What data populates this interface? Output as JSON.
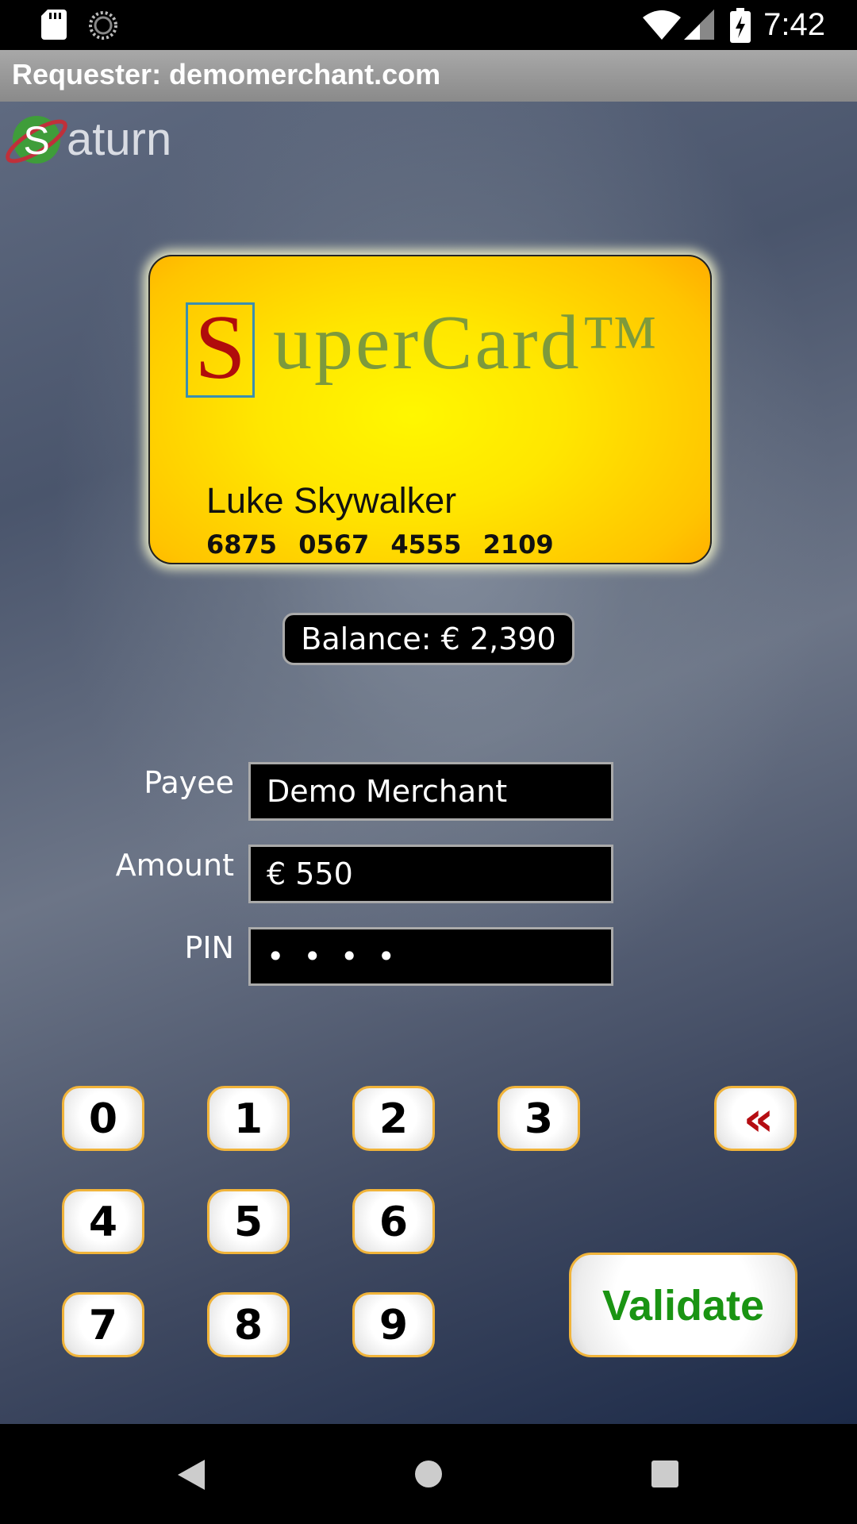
{
  "status_bar": {
    "time": "7:42",
    "icons": [
      "sd-card-icon",
      "sync-icon",
      "wifi-icon",
      "signal-icon",
      "battery-charging-icon"
    ]
  },
  "requester": {
    "text": "Requester: demomerchant.com"
  },
  "app": {
    "logo_letter": "S",
    "logo_text": "aturn"
  },
  "card": {
    "brand_initial": "S",
    "brand_rest": "uperCard™",
    "holder": "Luke Skywalker",
    "number": "6875 0567 4555 2109",
    "colors": {
      "gold": "#ffd200",
      "brand_red": "#b00c0c",
      "brand_green": "#7d9a3c",
      "logo_box": "#3a8fb0"
    }
  },
  "balance": {
    "text": "Balance: € 2,390"
  },
  "form": {
    "payee_label": "Payee",
    "payee_value": "Demo Merchant",
    "amount_label": "Amount",
    "amount_value": "€ 550",
    "pin_label": "PIN",
    "pin_value": "• • • •"
  },
  "keypad": {
    "keys": [
      "0",
      "1",
      "2",
      "3",
      "4",
      "5",
      "6",
      "7",
      "8",
      "9"
    ],
    "backspace": "«",
    "validate": "Validate",
    "colors": {
      "key_border": "#f1b43a",
      "validate_text": "#1a9413",
      "backspace_text": "#b50d12"
    }
  },
  "nav_bar": {
    "icons": [
      "back-icon",
      "home-icon",
      "recents-icon"
    ]
  }
}
